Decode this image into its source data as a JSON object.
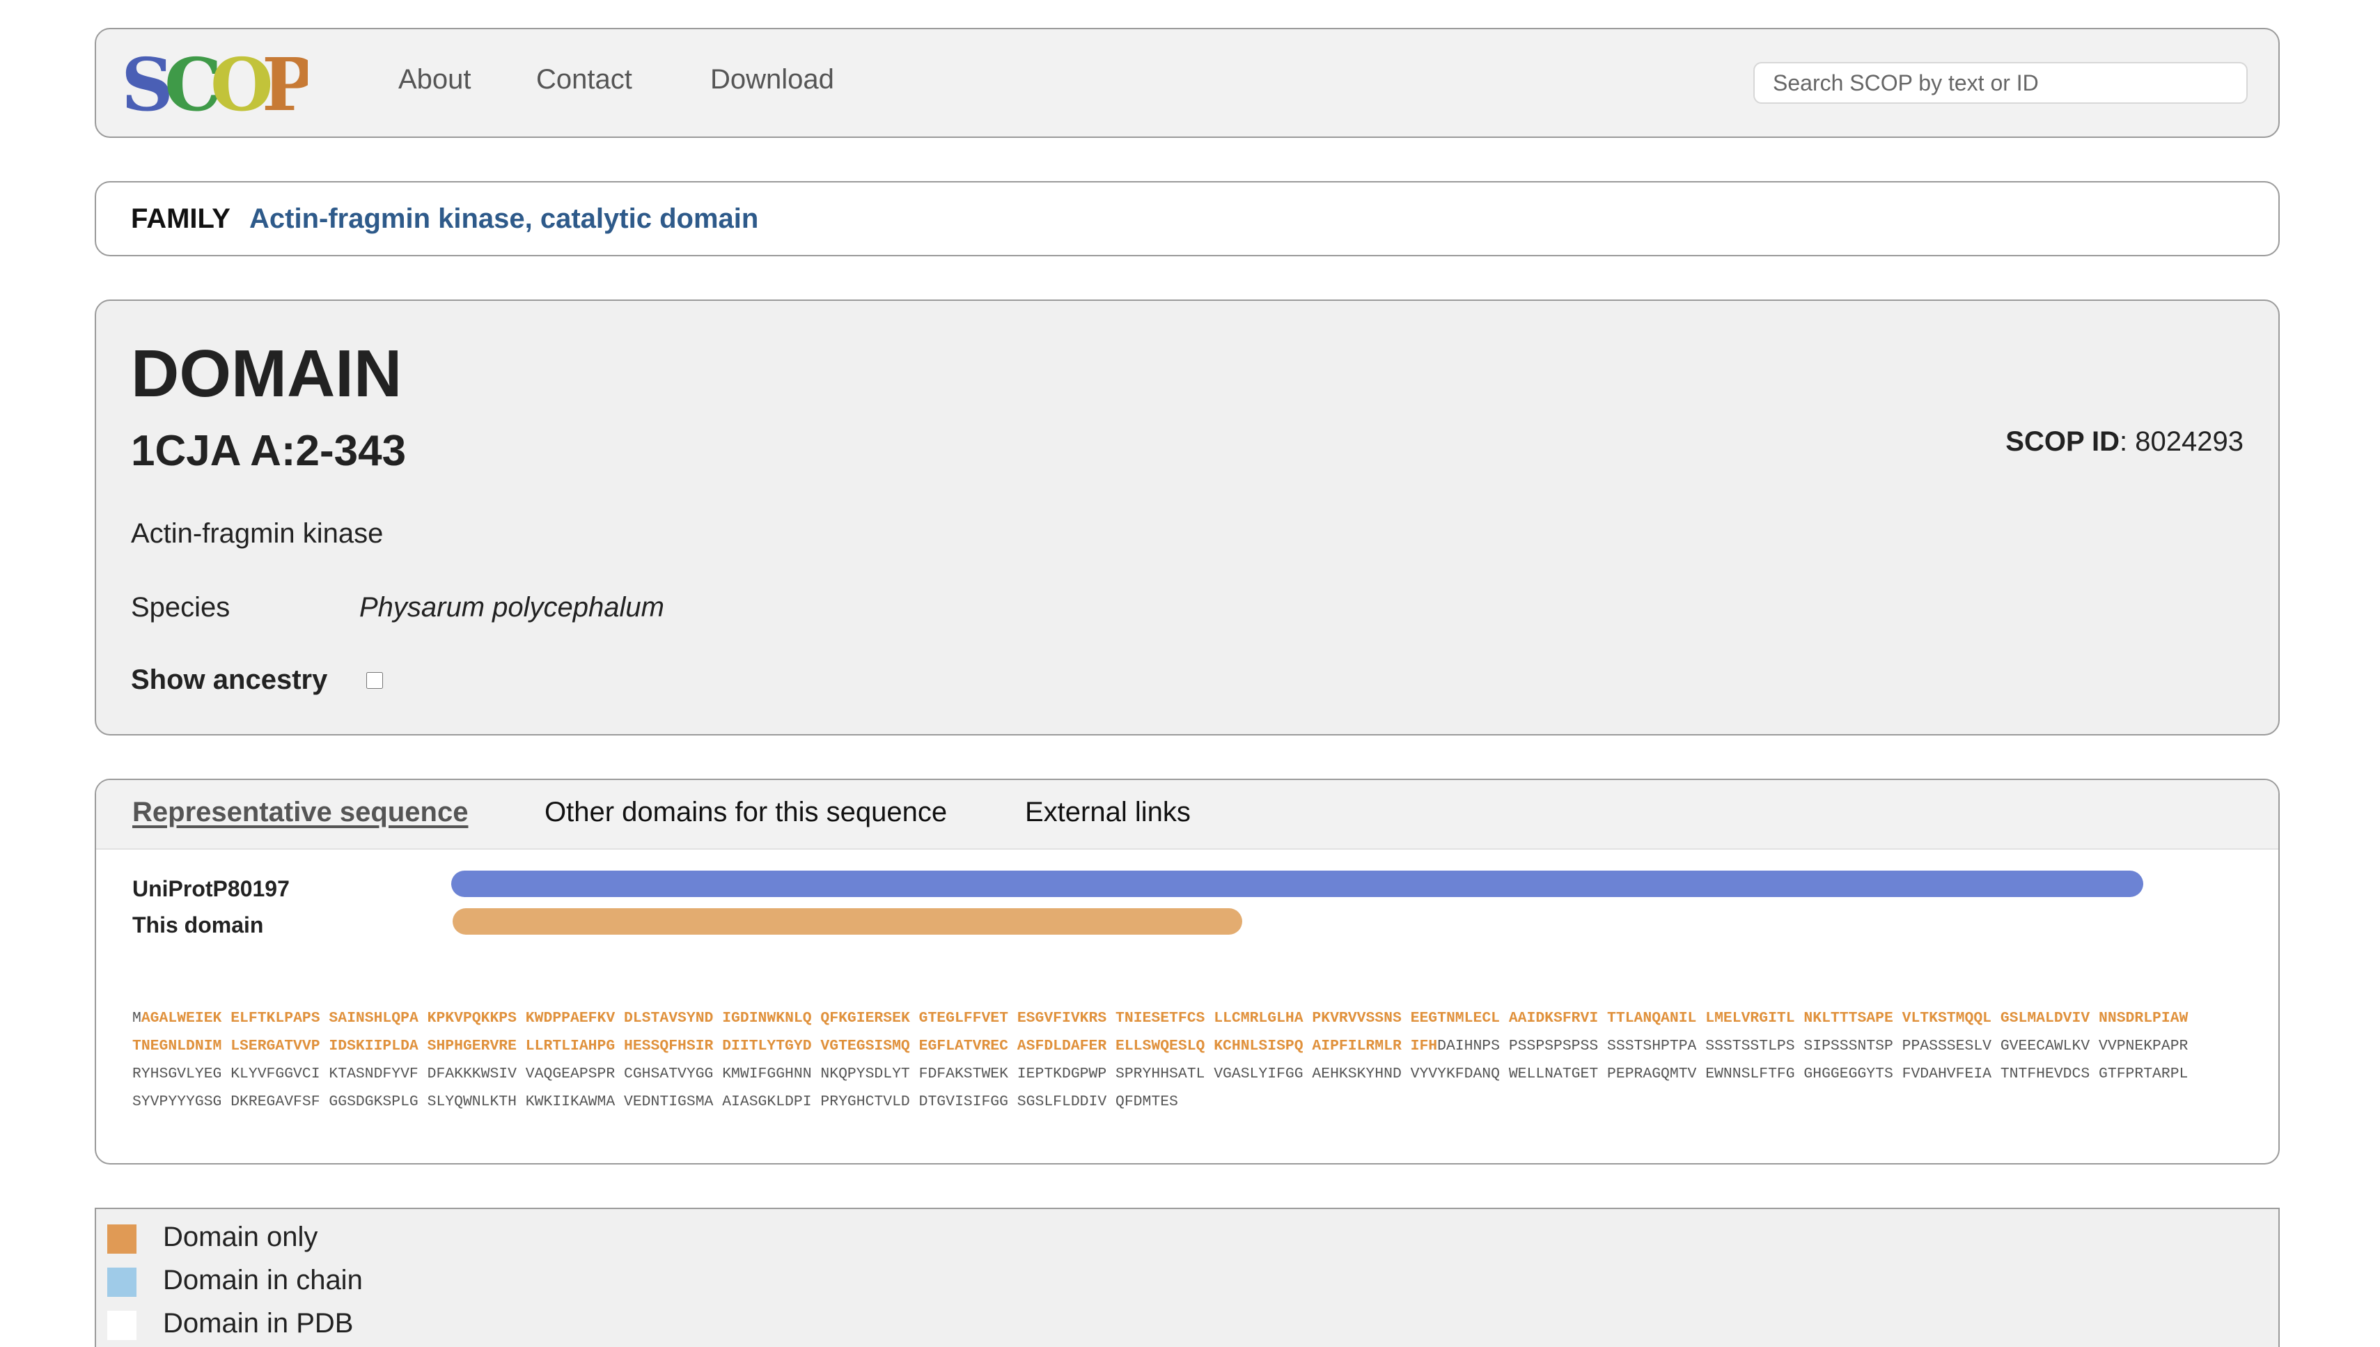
{
  "header": {
    "logo_text": "SCOP",
    "nav": [
      "About",
      "Contact",
      "Download"
    ],
    "search_placeholder": "Search SCOP by text or ID"
  },
  "family": {
    "label": "FAMILY",
    "name": "Actin-fragmin kinase, catalytic domain"
  },
  "domain": {
    "heading": "DOMAIN",
    "id": "1CJA A:2-343",
    "scop_id_label": "SCOP ID",
    "scop_id_value": ": 8024293",
    "protein": "Actin-fragmin kinase",
    "species_label": "Species",
    "species_value": "Physarum polycephalum",
    "ancestry_label": "Show ancestry",
    "ancestry_checked": false
  },
  "sequence_panel": {
    "tabs": [
      "Representative sequence",
      "Other domains for this sequence",
      "External links"
    ],
    "active_tab": 0,
    "tracks": [
      {
        "label": "UniProtP80197",
        "color": "#6c83d4"
      },
      {
        "label": "This domain",
        "color": "#e3ac70"
      }
    ],
    "sequence_lead": "M",
    "sequence_domain": "AGALWEIEK ELFTKLPAPS SAINSHLQPA KPKVPQKKPS KWDPPAEFKV DLSTAVSYND IGDINWKNLQ QFKGIERSEK GTEGLFFVET ESGVFIVKRS TNIESETFCS LLCMRLGLHA PKVRVVSSNS EEGTNMLECL AAIDKSFRVI TTLANQANIL LMELVRGITL NKLTTTSAPE VLTKSTMQQL GSLMALDVIV NNSDRLPIAW TNEGNLDNIM LSERGATVVP IDSKIIPLDA SHPHGERVRE LLRTLIAHPG HESSQFHSIR DIITLYTGYD VGTEGSISMQ EGFLATVREC ASFDLDAFER ELLSWQESLQ KCHNLSISPQ AIPFILRMLR IFH",
    "sequence_rest": "DAIHNPS PSSPSPSPSS SSSTSHPTPA SSSTSSTLPS SIPSSSNTSP PPASSSESLV GVEECAWLKV VVPNEKPAPR RYHSGVLYEG KLYVFGGVCI KTASNDFYVF DFAKKKWSIV VAQGEAPSPR CGHSATVYGG KMWIFGGHNN NKQPYSDLYT FDFAKSTWEK IEPTKDGPWP SPRYHHSATL VGASLYIFGG AEHKSKYHND VYVYKFDANQ WELLNATGET PEPRAGQMTV EWNNSLFTFG GHGGEGGYTS FVDAHVFEIA TNTFHEVDCS GTFPRTARPL SYVPYYYGSG DKREGAVFSF GGSDGKSPLG SLYQWNLKTH KWKIIKAWMA VEDNTIGSMA AIASGKLDPI PRYGHCTVLD DTGVISIFGG SGSLFLDDIV QFDMTES"
  },
  "legend": [
    {
      "label": "Domain only",
      "color": "#e09a55"
    },
    {
      "label": "Domain in chain",
      "color": "#9fcbe8"
    },
    {
      "label": "Domain in PDB",
      "color": "#ffffff"
    }
  ]
}
